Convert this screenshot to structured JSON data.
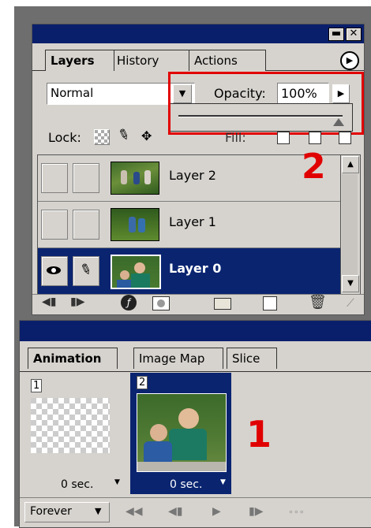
{
  "layers_panel": {
    "tabs": [
      "Layers",
      "History",
      "Actions"
    ],
    "blend_mode": "Normal",
    "opacity_label": "Opacity:",
    "opacity_value": "100%",
    "lock_label": "Lock:",
    "fill_label_partial": "Fill:",
    "layers": [
      {
        "name": "Layer 2",
        "selected": false,
        "visible": false
      },
      {
        "name": "Layer 1",
        "selected": false,
        "visible": false
      },
      {
        "name": "Layer 0",
        "selected": true,
        "visible": true
      }
    ],
    "window_buttons": [
      "▬",
      "✕"
    ]
  },
  "animation_panel": {
    "tabs": [
      "Animation",
      "Image Map",
      "Slice"
    ],
    "frames": [
      {
        "number": "1",
        "delay": "0 sec.",
        "selected": false
      },
      {
        "number": "2",
        "delay": "0 sec.",
        "selected": true
      }
    ],
    "loop": "Forever"
  },
  "annotations": {
    "step_1": "1",
    "step_2": "2",
    "highlight_color": "#e10000"
  },
  "colors": {
    "panel_bg": "#d6d3ce",
    "titlebar": "#0a1f6b",
    "selection": "#0a2470"
  }
}
